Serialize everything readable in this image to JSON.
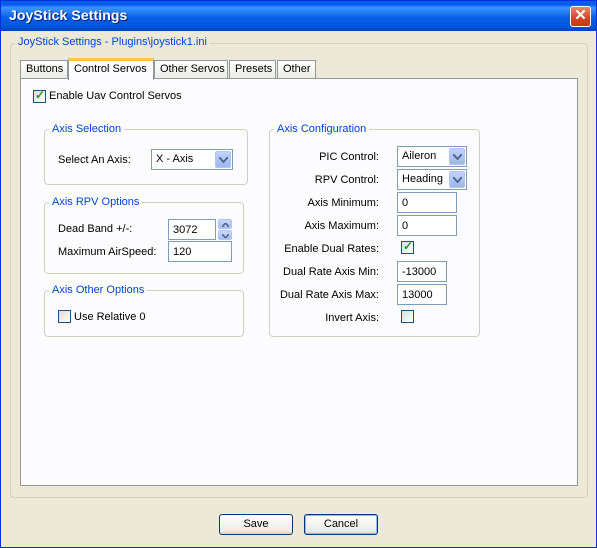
{
  "window": {
    "title": "JoyStick Settings"
  },
  "group_title": "JoyStick Settings - Plugins\\joystick1.ini",
  "tabs": [
    {
      "label": "Buttons",
      "active": false
    },
    {
      "label": "Control Servos",
      "active": true
    },
    {
      "label": "Other Servos",
      "active": false
    },
    {
      "label": "Presets",
      "active": false
    },
    {
      "label": "Other",
      "active": false
    }
  ],
  "enable_uav": {
    "label": "Enable Uav Control Servos",
    "checked": true
  },
  "axis_selection": {
    "legend": "Axis Selection",
    "select_label": "Select An Axis:",
    "select_value": "X - Axis"
  },
  "axis_rpv": {
    "legend": "Axis RPV Options",
    "deadband_label": "Dead Band +/-:",
    "deadband_value": "3072",
    "airspeed_label": "Maximum AirSpeed:",
    "airspeed_value": "120"
  },
  "axis_other": {
    "legend": "Axis Other Options",
    "relative_label": "Use Relative 0",
    "relative_checked": false
  },
  "axis_config": {
    "legend": "Axis Configuration",
    "pic_label": "PIC Control:",
    "pic_value": "Aileron",
    "rpv_label": "RPV Control:",
    "rpv_value": "Heading",
    "min_label": "Axis Minimum:",
    "min_value": "0",
    "max_label": "Axis Maximum:",
    "max_value": "0",
    "dual_label": "Enable Dual Rates:",
    "dual_checked": true,
    "dual_min_label": "Dual Rate Axis Min:",
    "dual_min_value": "-13000",
    "dual_max_label": "Dual Rate Axis Max:",
    "dual_max_value": "13000",
    "invert_label": "Invert Axis:",
    "invert_checked": false
  },
  "footer": {
    "save_label": "Save",
    "cancel_label": "Cancel"
  },
  "icons": {
    "close": "close-icon",
    "dropdown": "chevron-down-icon",
    "spin_up": "chevron-up-icon",
    "spin_down": "chevron-down-icon",
    "check": "checkmark-icon"
  },
  "colors": {
    "title_bar": "#0a5fe6",
    "legend_text": "#0046d5",
    "tab_highlight": "#ffc83c",
    "check_mark": "#21a121"
  }
}
